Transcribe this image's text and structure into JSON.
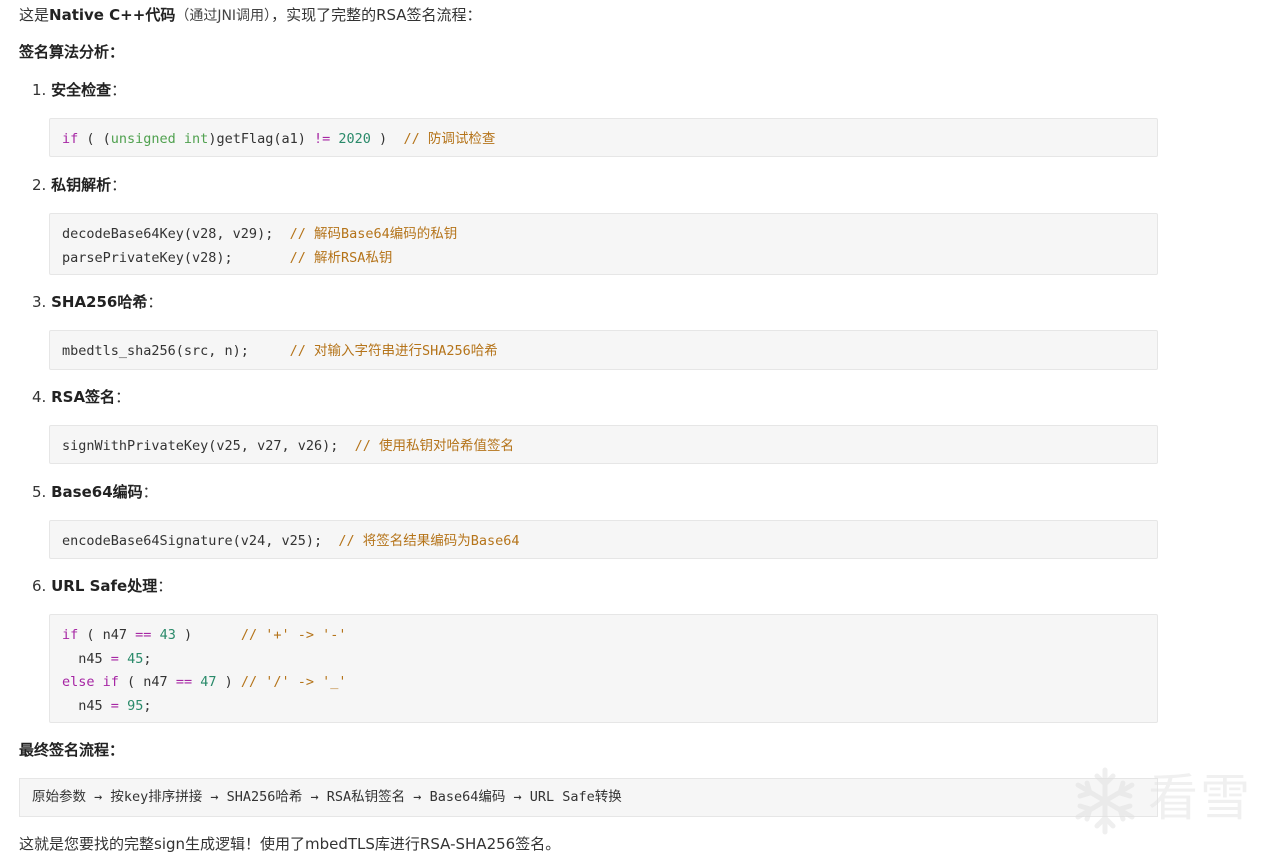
{
  "intro": {
    "prefix": "这是",
    "bold": "Native C++代码",
    "note": "（通过JNI调用）",
    "suffix": "，实现了完整的RSA签名流程："
  },
  "analysis_heading": "签名算法分析：",
  "steps": [
    {
      "num": "1.",
      "label": "安全检查",
      "colon": "：",
      "code": [
        [
          {
            "t": "if",
            "c": "kw"
          },
          {
            "t": " ( (",
            "c": ""
          },
          {
            "t": "unsigned int",
            "c": "ty"
          },
          {
            "t": ")getFlag(a1) ",
            "c": ""
          },
          {
            "t": "!=",
            "c": "op"
          },
          {
            "t": " ",
            "c": ""
          },
          {
            "t": "2020",
            "c": "num-lit"
          },
          {
            "t": " )  ",
            "c": ""
          },
          {
            "t": "// 防调试检查",
            "c": "cm"
          }
        ]
      ]
    },
    {
      "num": "2.",
      "label": "私钥解析",
      "colon": "：",
      "code": [
        [
          {
            "t": "decodeBase64Key(v28, v29);  ",
            "c": ""
          },
          {
            "t": "// 解码Base64编码的私钥",
            "c": "cm"
          }
        ],
        [
          {
            "t": "parsePrivateKey(v28);       ",
            "c": ""
          },
          {
            "t": "// 解析RSA私钥",
            "c": "cm"
          }
        ]
      ]
    },
    {
      "num": "3.",
      "label": "SHA256哈希",
      "colon": "：",
      "code": [
        [
          {
            "t": "mbedtls_sha256(src, n);     ",
            "c": ""
          },
          {
            "t": "// 对输入字符串进行SHA256哈希",
            "c": "cm"
          }
        ]
      ]
    },
    {
      "num": "4.",
      "label": "RSA签名",
      "colon": "：",
      "code": [
        [
          {
            "t": "signWithPrivateKey(v25, v27, v26);  ",
            "c": ""
          },
          {
            "t": "// 使用私钥对哈希值签名",
            "c": "cm"
          }
        ]
      ]
    },
    {
      "num": "5.",
      "label": "Base64编码",
      "colon": "：",
      "code": [
        [
          {
            "t": "encodeBase64Signature(v24, v25);  ",
            "c": ""
          },
          {
            "t": "// 将签名结果编码为Base64",
            "c": "cm"
          }
        ]
      ]
    },
    {
      "num": "6.",
      "label": "URL Safe处理",
      "colon": "：",
      "code": [
        [
          {
            "t": "if",
            "c": "kw"
          },
          {
            "t": " ( n47 ",
            "c": ""
          },
          {
            "t": "==",
            "c": "op"
          },
          {
            "t": " ",
            "c": ""
          },
          {
            "t": "43",
            "c": "num-lit"
          },
          {
            "t": " )      ",
            "c": ""
          },
          {
            "t": "// '+' -> '-'",
            "c": "cm"
          }
        ],
        [
          {
            "t": "  n45 ",
            "c": ""
          },
          {
            "t": "=",
            "c": "op"
          },
          {
            "t": " ",
            "c": ""
          },
          {
            "t": "45",
            "c": "num-lit"
          },
          {
            "t": ";",
            "c": ""
          }
        ],
        [
          {
            "t": "else if",
            "c": "kw"
          },
          {
            "t": " ( n47 ",
            "c": ""
          },
          {
            "t": "==",
            "c": "op"
          },
          {
            "t": " ",
            "c": ""
          },
          {
            "t": "47",
            "c": "num-lit"
          },
          {
            "t": " ) ",
            "c": ""
          },
          {
            "t": "// '/' -> '_'",
            "c": "cm"
          }
        ],
        [
          {
            "t": "  n45 ",
            "c": ""
          },
          {
            "t": "=",
            "c": "op"
          },
          {
            "t": " ",
            "c": ""
          },
          {
            "t": "95",
            "c": "num-lit"
          },
          {
            "t": ";",
            "c": ""
          }
        ]
      ]
    }
  ],
  "final_heading": "最终签名流程：",
  "flow": "原始参数 → 按key排序拼接 → SHA256哈希 → RSA私钥签名 → Base64编码 → URL Safe转换",
  "conclusion": "这就是您要找的完整sign生成逻辑！使用了mbedTLS库进行RSA-SHA256签名。",
  "watermark": {
    "text": "看雪",
    "icon": "snowflake-icon"
  },
  "colors": {
    "keyword": "#a626a4",
    "type": "#50a14f",
    "number": "#2a8a6a",
    "comment": "#b5741a",
    "code_bg": "#f6f6f6"
  }
}
